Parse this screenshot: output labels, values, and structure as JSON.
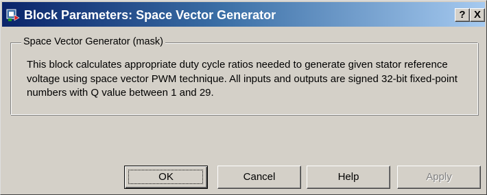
{
  "window": {
    "title": "Block Parameters: Space Vector Generator",
    "icon": "simulink-block-icon",
    "help_button": "?",
    "close_button": "X"
  },
  "group": {
    "legend": "Space Vector Generator (mask)",
    "description": "This block calculates appropriate duty cycle ratios needed to generate given stator reference voltage using space vector PWM technique. All inputs and outputs are signed 32-bit fixed-point numbers with Q value between 1 and 29."
  },
  "buttons": {
    "ok": "OK",
    "cancel": "Cancel",
    "help": "Help",
    "apply": "Apply"
  },
  "colors": {
    "titlebar_start": "#0a246a",
    "titlebar_end": "#a6caf0",
    "dialog_face": "#d4d0c8",
    "disabled_text": "#808080"
  }
}
